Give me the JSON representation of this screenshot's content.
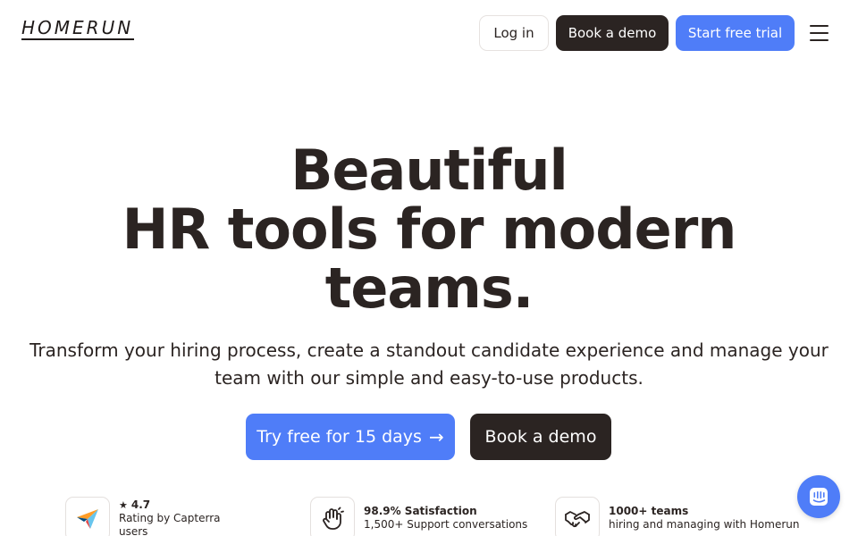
{
  "header": {
    "logo": "HOMERUN",
    "login_label": "Log in",
    "demo_label": "Book a demo",
    "trial_label": "Start free trial"
  },
  "hero": {
    "headline_line1": "Beautiful",
    "headline_line2": "HR tools for modern",
    "headline_line3": "teams.",
    "subtext_line1": "Transform your hiring process, create a standout candidate experience and manage your",
    "subtext_line2": "team with our simple and easy-to-use products.",
    "cta_trial_label": "Try free for 15 days",
    "cta_demo_label": "Book a demo"
  },
  "stats": [
    {
      "icon": "capterra-icon",
      "title": "4.7",
      "sub1": "Rating by Capterra",
      "sub2": "users"
    },
    {
      "icon": "hand-wave-icon",
      "title": "98.9% Satisfaction",
      "sub1": "1,500+ Support conversations"
    },
    {
      "icon": "handshake-icon",
      "title": "1000+ teams",
      "sub1": "hiring and managing with Homerun"
    }
  ],
  "colors": {
    "accent": "#4f7df8",
    "dark": "#2b2422"
  },
  "icons": {
    "menu": "hamburger-menu-icon",
    "chat": "chat-icon",
    "arrow": "arrow-right-icon",
    "star": "star-icon"
  }
}
